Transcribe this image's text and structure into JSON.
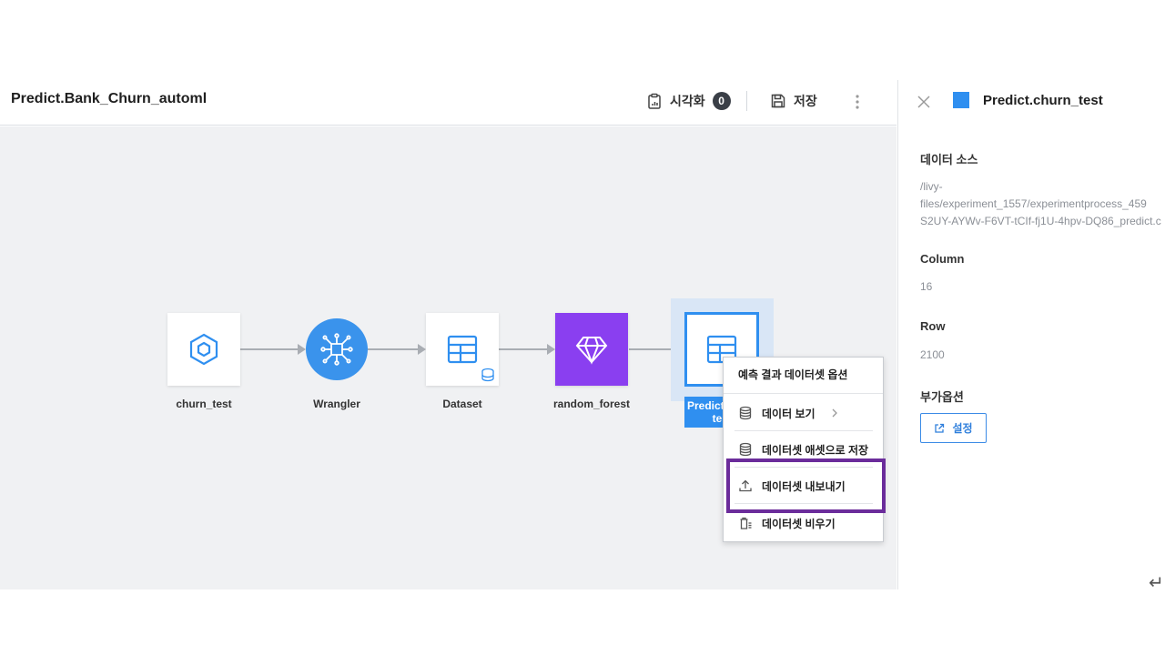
{
  "header": {
    "title": "Predict.Bank_Churn_automl",
    "visualize_label": "시각화",
    "visualize_count": "0",
    "save_label": "저장"
  },
  "pipeline": {
    "nodes": [
      {
        "label": "churn_test",
        "icon": "hexagon-icon"
      },
      {
        "label": "Wrangler",
        "icon": "wrangler-icon"
      },
      {
        "label": "Dataset",
        "icon": "table-icon"
      },
      {
        "label": "random_forest",
        "icon": "diamond-icon"
      },
      {
        "label": "Predict.churn_test",
        "label_line1": "Predict.",
        "label_line2": "te",
        "icon": "table-icon"
      }
    ]
  },
  "context_menu": {
    "header": "예측 결과 데이터셋 옵션",
    "items": [
      {
        "label": "데이터 보기",
        "icon": "database-icon",
        "has_submenu": true
      },
      {
        "label": "데이터셋 애셋으로 저장",
        "icon": "database-icon"
      },
      {
        "label": "데이터셋 내보내기",
        "icon": "upload-icon",
        "highlighted": true
      },
      {
        "label": "데이터셋 비우기",
        "icon": "trash-icon"
      }
    ]
  },
  "panel": {
    "title": "Predict.churn_test",
    "data_source_label": "데이터 소스",
    "data_source_lines": [
      "/livy-",
      "files/experiment_1557/experimentprocess_459",
      "S2UY-AYWv-F6VT-tCIf-fj1U-4hpv-DQ86_predict.c"
    ],
    "column_label": "Column",
    "column_value": "16",
    "row_label": "Row",
    "row_value": "2100",
    "extra_label": "부가옵션",
    "settings_label": "설정"
  },
  "colors": {
    "accent": "#2f8ff0",
    "model_node": "#8a3ff0",
    "highlight_border": "#6b2c9b"
  }
}
